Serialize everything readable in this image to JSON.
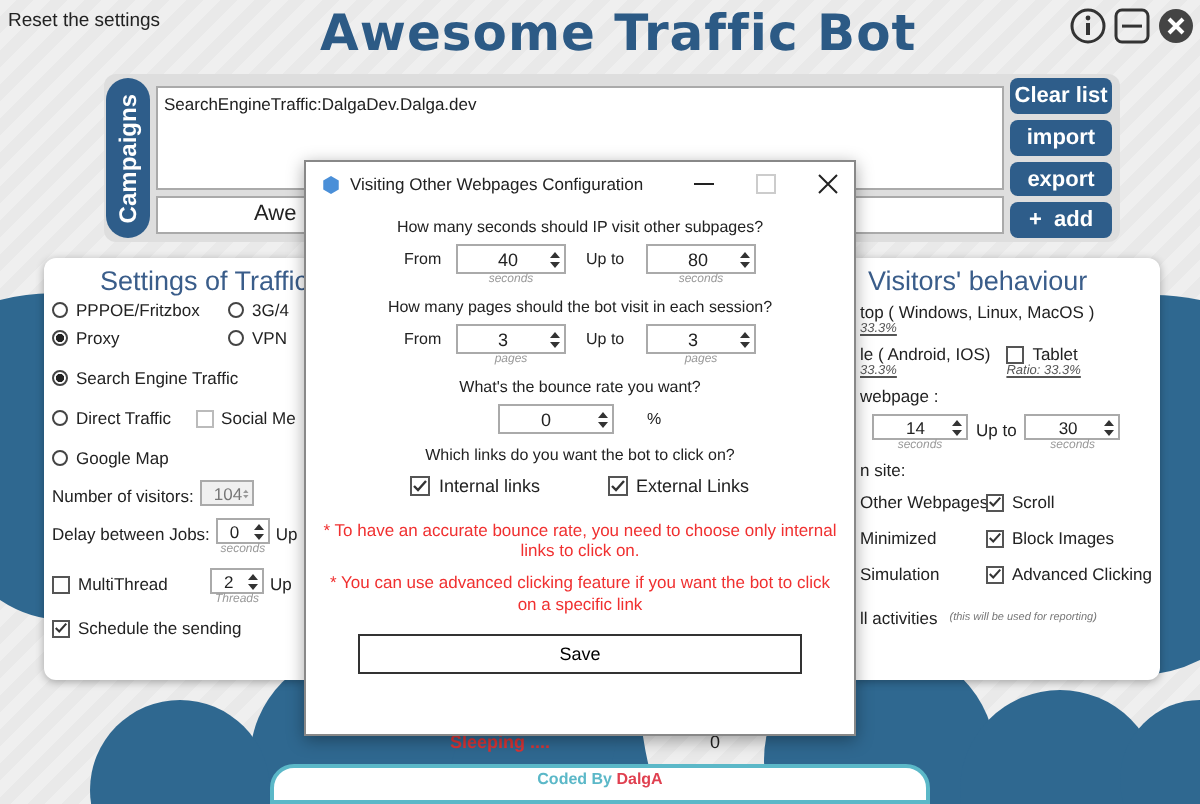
{
  "header": {
    "reset_link": "Reset the settings",
    "title": "Awesome Traffic Bot"
  },
  "campaigns": {
    "tab_label": "Campaigns",
    "list": [
      "SearchEngineTraffic:DalgaDev.Dalga.dev"
    ],
    "name_field": "Awe",
    "buttons": [
      "Clear list",
      "import",
      "export",
      "+  add"
    ]
  },
  "traffic_settings": {
    "title": "Settings of Traffic",
    "connection": [
      {
        "label": "PPPOE/Fritzbox",
        "selected": false
      },
      {
        "label": "3G/4",
        "selected": false
      },
      {
        "label": "Proxy",
        "selected": true
      },
      {
        "label": "VPN",
        "selected": false
      }
    ],
    "source": [
      {
        "label": "Search Engine Traffic",
        "selected": true
      },
      {
        "label": "Direct Traffic",
        "selected": false,
        "side_checkbox": {
          "label": "Social Me",
          "checked": false
        }
      },
      {
        "label": "Google Map",
        "selected": false
      }
    ],
    "visitors": {
      "label": "Number of visitors:",
      "value": "104",
      "disabled": true
    },
    "delay": {
      "label": "Delay between Jobs:",
      "value": "0",
      "unit": "seconds",
      "next": "Up"
    },
    "multithread": {
      "label": "MultiThread",
      "checked": false,
      "value": "2",
      "unit": "Threads",
      "next": "Up"
    },
    "schedule": {
      "label": "Schedule the sending",
      "checked": true
    }
  },
  "visitors_behaviour": {
    "title": "Visitors' behaviour",
    "devices": [
      {
        "label": "top ( Windows, Linux, MacOS )",
        "ratio": "33.3%"
      },
      {
        "label": "le ( Android, IOS)",
        "ratio": "33.3%",
        "side_checkbox": {
          "label": "Tablet",
          "checked": false,
          "ratio": "Ratio: 33.3%"
        }
      }
    ],
    "stay_label": "webpage :",
    "stay_from": {
      "value": "14",
      "unit": "seconds"
    },
    "stay_to_label": "Up to",
    "stay_to": {
      "value": "30",
      "unit": "seconds"
    },
    "on_site_label": "n site:",
    "options": [
      {
        "label": "Other Webpages",
        "kind": "text"
      },
      {
        "label": "Scroll",
        "kind": "checkbox",
        "checked": true
      },
      {
        "label": "Minimized",
        "kind": "text"
      },
      {
        "label": "Block Images",
        "kind": "checkbox",
        "checked": true
      },
      {
        "label": "Simulation",
        "kind": "text"
      },
      {
        "label": "Advanced Clicking",
        "kind": "checkbox",
        "checked": true
      }
    ],
    "log": {
      "label": "ll activities",
      "note": "(this will be used for reporting)"
    }
  },
  "status": {
    "label": "Sleeping ....",
    "value": "0"
  },
  "footer": {
    "prefix": "Coded By",
    "author": "DalgA"
  },
  "dialog": {
    "title": "Visiting Other Webpages Configuration",
    "ranges": [
      {
        "question": "How many seconds should IP visit other subpages?",
        "from_label": "From",
        "from": "40",
        "from_unit": "seconds",
        "to_label": "Up to",
        "to": "80",
        "to_unit": "seconds"
      },
      {
        "question": "How many pages should the bot visit in each session?",
        "from_label": "From",
        "from": "3",
        "from_unit": "pages",
        "to_label": "Up to",
        "to": "3",
        "to_unit": "pages"
      }
    ],
    "bounce": {
      "question": "What's the bounce rate you want?",
      "value": "0",
      "unit": "%"
    },
    "links": {
      "question": "Which links do you want the bot to click on?",
      "options": [
        {
          "label": "Internal links",
          "checked": true
        },
        {
          "label": "External Links",
          "checked": true
        }
      ]
    },
    "notes": [
      "* To have an accurate bounce rate, you need to choose only internal links to click on.",
      "* You can use advanced clicking feature if you want the bot to click on a specific link"
    ],
    "save": "Save"
  }
}
